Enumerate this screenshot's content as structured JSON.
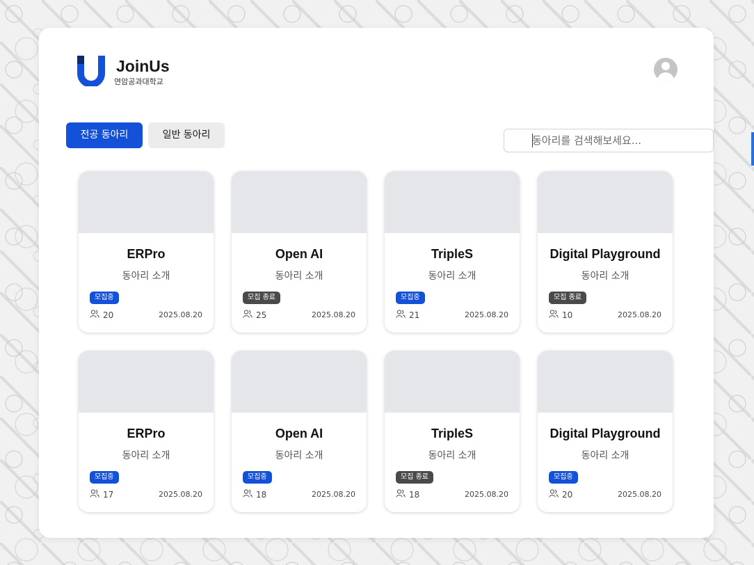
{
  "header": {
    "brand_name": "JoinUs",
    "brand_sub": "연암공과대학교"
  },
  "tabs": {
    "major": "전공 동아리",
    "general": "일반 동아리",
    "active": "major"
  },
  "search": {
    "placeholder": "동아리를 검색해보세요..."
  },
  "colors": {
    "accent": "#1351d8",
    "closed_badge": "#4a4a4a",
    "thumb": "#e5e6ea"
  },
  "clubs": [
    {
      "name": "ERPro",
      "desc": "동아리 소개",
      "status": "모집중",
      "status_type": "open",
      "members": "20",
      "date": "2025.08.20"
    },
    {
      "name": "Open AI",
      "desc": "동아리 소개",
      "status": "모집 종료",
      "status_type": "closed",
      "members": "25",
      "date": "2025.08.20"
    },
    {
      "name": "TripleS",
      "desc": "동아리 소개",
      "status": "모집중",
      "status_type": "open",
      "members": "21",
      "date": "2025.08.20"
    },
    {
      "name": "Digital Playground",
      "desc": "동아리 소개",
      "status": "모집 종료",
      "status_type": "closed",
      "members": "10",
      "date": "2025.08.20"
    },
    {
      "name": "ERPro",
      "desc": "동아리 소개",
      "status": "모집중",
      "status_type": "open",
      "members": "17",
      "date": "2025.08.20"
    },
    {
      "name": "Open AI",
      "desc": "동아리 소개",
      "status": "모집중",
      "status_type": "open",
      "members": "18",
      "date": "2025.08.20"
    },
    {
      "name": "TripleS",
      "desc": "동아리 소개",
      "status": "모집 종료",
      "status_type": "closed",
      "members": "18",
      "date": "2025.08.20"
    },
    {
      "name": "Digital Playground",
      "desc": "동아리 소개",
      "status": "모집중",
      "status_type": "open",
      "members": "20",
      "date": "2025.08.20"
    }
  ]
}
